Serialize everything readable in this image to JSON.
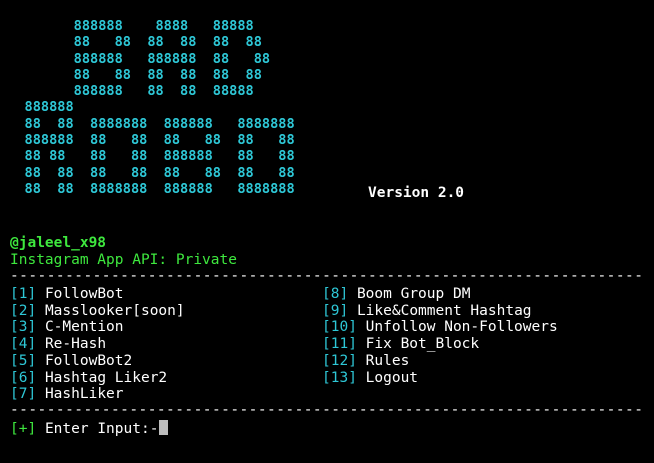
{
  "banner": {
    "lines": [
      "         888888    8888   88888",
      "         88   88  88  88  88  88",
      "         888888   888888  88   88",
      "         88   88  88  88  88  88",
      "         888888   88  88  88888",
      "   888888",
      "   88  88  8888888  888888   8888888",
      "   888888  88   88  88   88  88   88",
      "   88 88   88   88  888888   88   88",
      "   88  88  88   88  88   88  88   88",
      "   88  88  8888888  888888   8888888"
    ],
    "version": "Version 2.0"
  },
  "info": {
    "author": "@jaleel_x98",
    "api_id": "Instagram App API: Private"
  },
  "separator": "---------------------------------------------------------------------",
  "menu": {
    "left": [
      {
        "num": "[1]",
        "label": "FollowBot"
      },
      {
        "num": "[2]",
        "label": "Masslooker[soon]"
      },
      {
        "num": "[3]",
        "label": "C-Mention"
      },
      {
        "num": "[4]",
        "label": "Re-Hash"
      },
      {
        "num": "[5]",
        "label": "FollowBot2"
      },
      {
        "num": "[6]",
        "label": "Hashtag Liker2"
      },
      {
        "num": "[7]",
        "label": "HashLiker"
      }
    ],
    "right": [
      {
        "num": "[8]",
        "label": "Boom Group DM"
      },
      {
        "num": "[9]",
        "label": "Like&Comment Hashtag"
      },
      {
        "num": "[10]",
        "label": "Unfollow Non-Followers"
      },
      {
        "num": "[11]",
        "label": "Fix Bot_Block"
      },
      {
        "num": "[12]",
        "label": "Rules"
      },
      {
        "num": "[13]",
        "label": "Logout"
      }
    ]
  },
  "prompt": {
    "marker": "[+]",
    "text": "Enter Input:-"
  },
  "colors": {
    "background": "#000000",
    "cyan": "#2ec7d6",
    "green": "#3ee83e",
    "white": "#ffffff"
  }
}
